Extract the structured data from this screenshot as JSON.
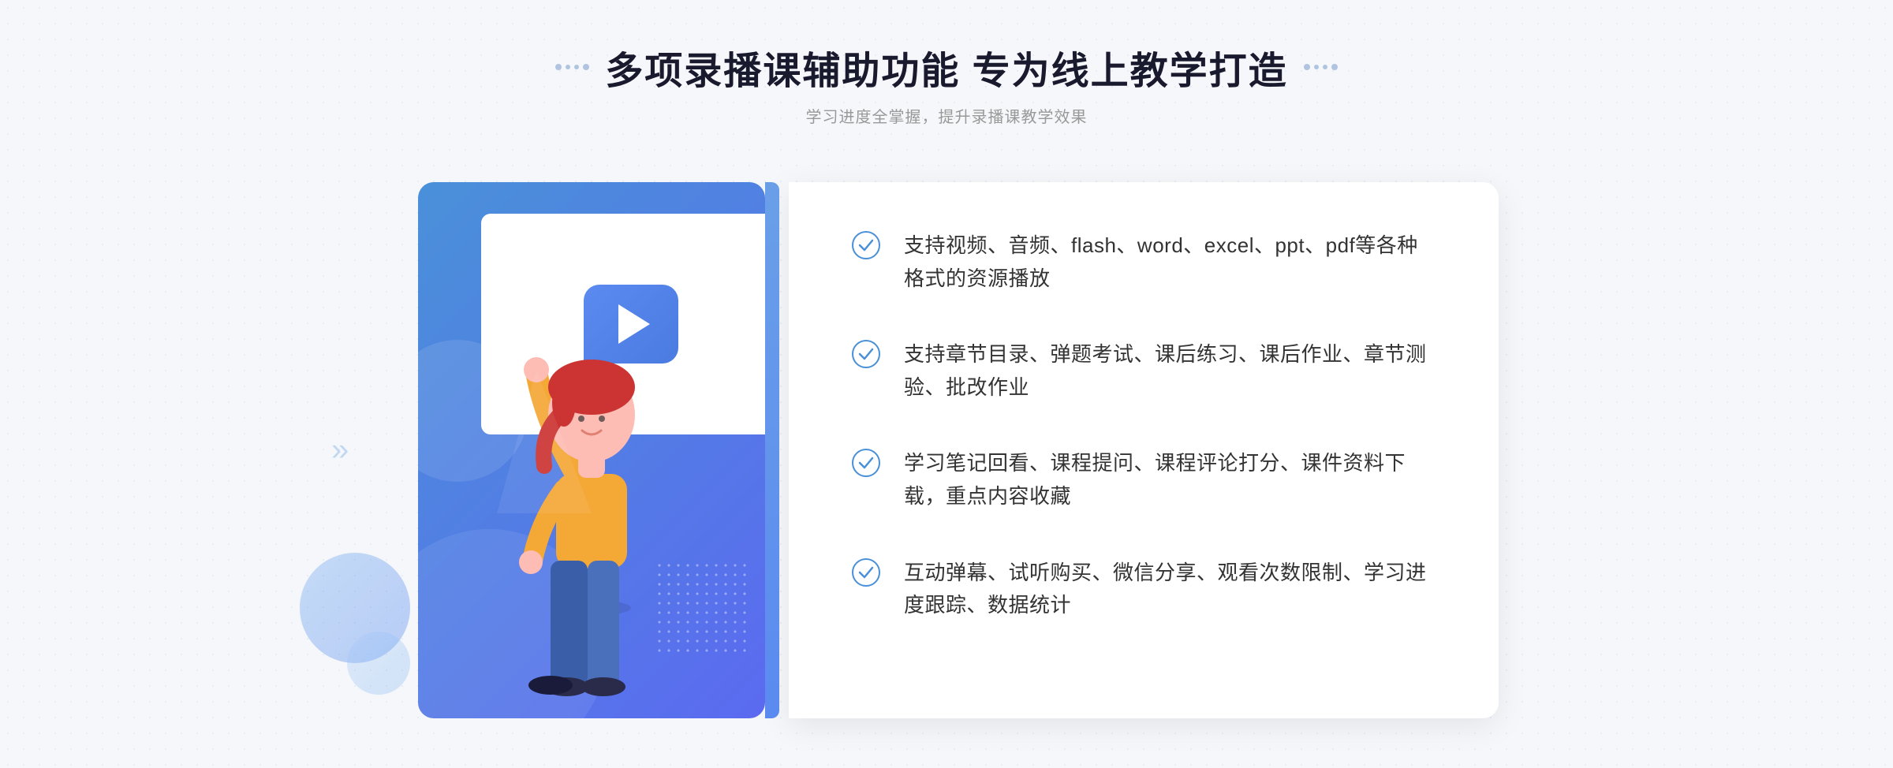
{
  "page": {
    "background_color": "#f5f7fa"
  },
  "header": {
    "title": "多项录播课辅助功能 专为线上教学打造",
    "subtitle": "学习进度全掌握，提升录播课教学效果"
  },
  "features": [
    {
      "id": 1,
      "text": "支持视频、音频、flash、word、excel、ppt、pdf等各种格式的资源播放"
    },
    {
      "id": 2,
      "text": "支持章节目录、弹题考试、课后练习、课后作业、章节测验、批改作业"
    },
    {
      "id": 3,
      "text": "学习笔记回看、课程提问、课程评论打分、课件资料下载，重点内容收藏"
    },
    {
      "id": 4,
      "text": "互动弹幕、试听购买、微信分享、观看次数限制、学习进度跟踪、数据统计"
    }
  ],
  "icons": {
    "check_circle": "✓",
    "play_icon": "▶",
    "chevron_left": "《",
    "dots_left": "⁞⁞",
    "dots_right": "⁞⁞"
  },
  "colors": {
    "primary_blue": "#4a90d9",
    "accent_blue": "#5b6af0",
    "text_dark": "#1a1a2e",
    "text_light": "#999999",
    "text_feature": "#333333",
    "check_color": "#4a90d9",
    "white": "#ffffff"
  }
}
